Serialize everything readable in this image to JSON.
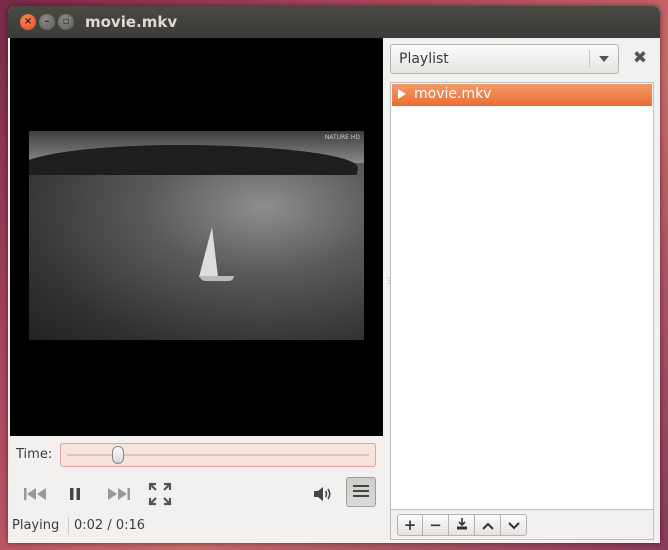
{
  "window": {
    "title": "movie.mkv",
    "buttons": {
      "close_icon": "close-icon",
      "minimize_icon": "minimize-icon",
      "maximize_icon": "maximize-icon"
    }
  },
  "video": {
    "watermark": "NATURE HD"
  },
  "seek": {
    "label": "Time:",
    "position_fraction": 0.18
  },
  "controls": {
    "icons": [
      "previous-icon",
      "pause-icon",
      "next-icon",
      "fullscreen-icon",
      "volume-icon",
      "playlist-toggle-icon"
    ]
  },
  "status": {
    "state": "Playing",
    "time": "0:02 / 0:16"
  },
  "playlist": {
    "selector_value": "Playlist",
    "items": [
      {
        "label": "movie.mkv",
        "active": true
      }
    ],
    "tools": [
      {
        "icon": "add-icon",
        "glyph": "+"
      },
      {
        "icon": "remove-icon",
        "glyph": "−"
      },
      {
        "icon": "save-icon",
        "glyph": ""
      },
      {
        "icon": "move-up-icon",
        "glyph": ""
      },
      {
        "icon": "move-down-icon",
        "glyph": ""
      }
    ]
  },
  "colors": {
    "accent": "#e96e32",
    "titlebar": "#3c3b37",
    "close_button": "#df4a1e"
  }
}
